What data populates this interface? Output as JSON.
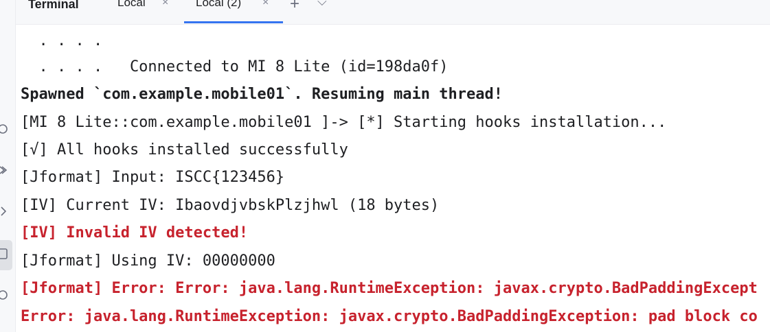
{
  "tabbar": {
    "title": "Terminal",
    "tabs": [
      {
        "label": "Local",
        "close": "×"
      },
      {
        "label": "Local (2)",
        "close": "×"
      }
    ],
    "add_label": "+",
    "dropdown_label": "⌵"
  },
  "left_toolbar": {
    "icons": [
      "run-icon",
      "build-icon",
      "git-icon",
      "terminal-icon",
      "problems-icon"
    ]
  },
  "terminal": {
    "lines": [
      {
        "text": "  . . . .",
        "style": "normal"
      },
      {
        "text": "  . . . .   Connected to MI 8 Lite (id=198da0f)",
        "style": "normal"
      },
      {
        "text": "Spawned `com.example.mobile01`. Resuming main thread!",
        "style": "bold"
      },
      {
        "text": "[MI 8 Lite::com.example.mobile01 ]-> [*] Starting hooks installation...",
        "style": "normal"
      },
      {
        "text": "[√] All hooks installed successfully",
        "style": "normal"
      },
      {
        "text": "[Jformat] Input: ISCC{123456}",
        "style": "normal"
      },
      {
        "text": "[IV] Current IV: IbaovdjvbskPlzjhwl (18 bytes)",
        "style": "normal"
      },
      {
        "text": "[IV] Invalid IV detected!",
        "style": "error"
      },
      {
        "text": "[Jformat] Using IV: 00000000",
        "style": "normal"
      },
      {
        "text": "[Jformat] Error: Error: java.lang.RuntimeException: javax.crypto.BadPaddingExcept",
        "style": "error"
      },
      {
        "text": "Error: java.lang.RuntimeException: javax.crypto.BadPaddingException: pad block co",
        "style": "error"
      }
    ]
  },
  "colors": {
    "error": "#c7222d",
    "accent": "#3574f0",
    "text": "#1e1f22",
    "chrome": "#f7f8fa"
  }
}
